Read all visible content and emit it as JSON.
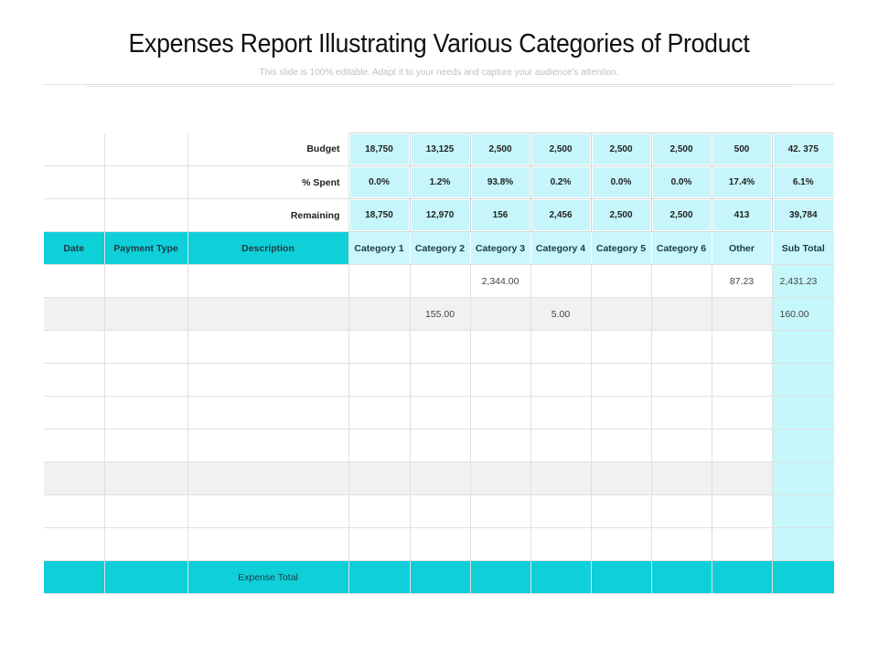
{
  "slide": {
    "title": "Expenses Report Illustrating Various Categories of Product",
    "subtitle": "This slide is 100% editable. Adapt it to your needs and capture your audience's attention."
  },
  "summary": {
    "rows": [
      {
        "label": "Budget",
        "values": [
          "18,750",
          "13,125",
          "2,500",
          "2,500",
          "2,500",
          "2,500",
          "500",
          "42. 375"
        ]
      },
      {
        "label": "% Spent",
        "values": [
          "0.0%",
          "1.2%",
          "93.8%",
          "0.2%",
          "0.0%",
          "0.0%",
          "17.4%",
          "6.1%"
        ]
      },
      {
        "label": "Remaining",
        "values": [
          "18,750",
          "12,970",
          "156",
          "2,456",
          "2,500",
          "2,500",
          "413",
          "39,784"
        ]
      }
    ]
  },
  "table": {
    "columns": [
      "Date",
      "Payment Type",
      "Description",
      "Category 1",
      "Category 2",
      "Category 3",
      "Category 4",
      "Category 5",
      "Category 6",
      "Other",
      "Sub Total"
    ],
    "rows": [
      [
        "",
        "",
        "",
        "",
        "",
        "2,344.00",
        "",
        "",
        "",
        "87.23",
        "2,431.23"
      ],
      [
        "",
        "",
        "",
        "",
        "155.00",
        "",
        "5.00",
        "",
        "",
        "",
        "160.00"
      ],
      [
        "",
        "",
        "",
        "",
        "",
        "",
        "",
        "",
        "",
        "",
        ""
      ],
      [
        "",
        "",
        "",
        "",
        "",
        "",
        "",
        "",
        "",
        "",
        ""
      ],
      [
        "",
        "",
        "",
        "",
        "",
        "",
        "",
        "",
        "",
        "",
        ""
      ],
      [
        "",
        "",
        "",
        "",
        "",
        "",
        "",
        "",
        "",
        "",
        ""
      ],
      [
        "",
        "",
        "",
        "",
        "",
        "",
        "",
        "",
        "",
        "",
        ""
      ],
      [
        "",
        "",
        "",
        "",
        "",
        "",
        "",
        "",
        "",
        "",
        ""
      ],
      [
        "",
        "",
        "",
        "",
        "",
        "",
        "",
        "",
        "",
        "",
        ""
      ]
    ],
    "footer_label": "Expense Total"
  },
  "colors": {
    "header_teal": "#0fcfd9",
    "light_cyan": "#c6f6fb",
    "grey_row": "#f1f1f1"
  }
}
